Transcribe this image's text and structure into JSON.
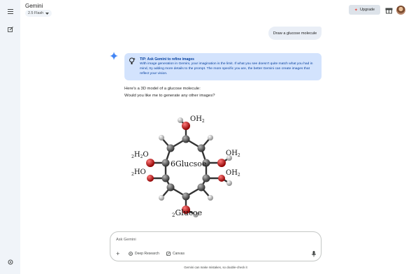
{
  "app": {
    "title": "Gemini",
    "model": "2.5 Flash",
    "upgrade_label": "Upgrade"
  },
  "sidebar": {
    "icons": [
      "menu-icon",
      "new-chat-icon",
      "settings-icon"
    ]
  },
  "conversation": {
    "user_message": "Draw a glucose molecule",
    "tip": {
      "title": "TIP: Ask Gemini to refine images",
      "body": "With image generation in Gemini, your imagination is the limit. If what you see doesn't quite match what you had in mind, try adding more details to the prompt. The more specific you are, the better Gemini can create images that reflect your vision."
    },
    "response_line1": "Here's a 3D model of a glucose molecule:",
    "response_line2": "Would you like me to generate any other images?",
    "image_labels": {
      "oh_top": "OH",
      "oh_top_sub": "2",
      "h2o_left_pre": "2",
      "h2o_left": "H",
      "h2o_left_sub": "2",
      "h2o_left_post": "O",
      "ho_left_pre": "2",
      "ho_left": "HO",
      "center": "6Glucsoe",
      "oh_right1": "OH",
      "oh_right1_sub": "2",
      "oh_right2": "OH",
      "oh_right2_sub": "2",
      "bottom_pre": "2",
      "bottom": "Glucoe"
    }
  },
  "composer": {
    "placeholder": "Ask Gemini",
    "deep_research_label": "Deep Research",
    "canvas_label": "Canvas"
  },
  "footer": {
    "disclaimer": "Gemini can make mistakes, so double-check it"
  },
  "colors": {
    "rail_bg": "#f0f4f9",
    "tip_bg": "#d3e3fd",
    "tip_text": "#0842a0",
    "user_bubble": "#e9eef6",
    "spark_blue": "#4285f4",
    "oxygen_red": "#cc0000",
    "carbon_gray": "#555555"
  }
}
